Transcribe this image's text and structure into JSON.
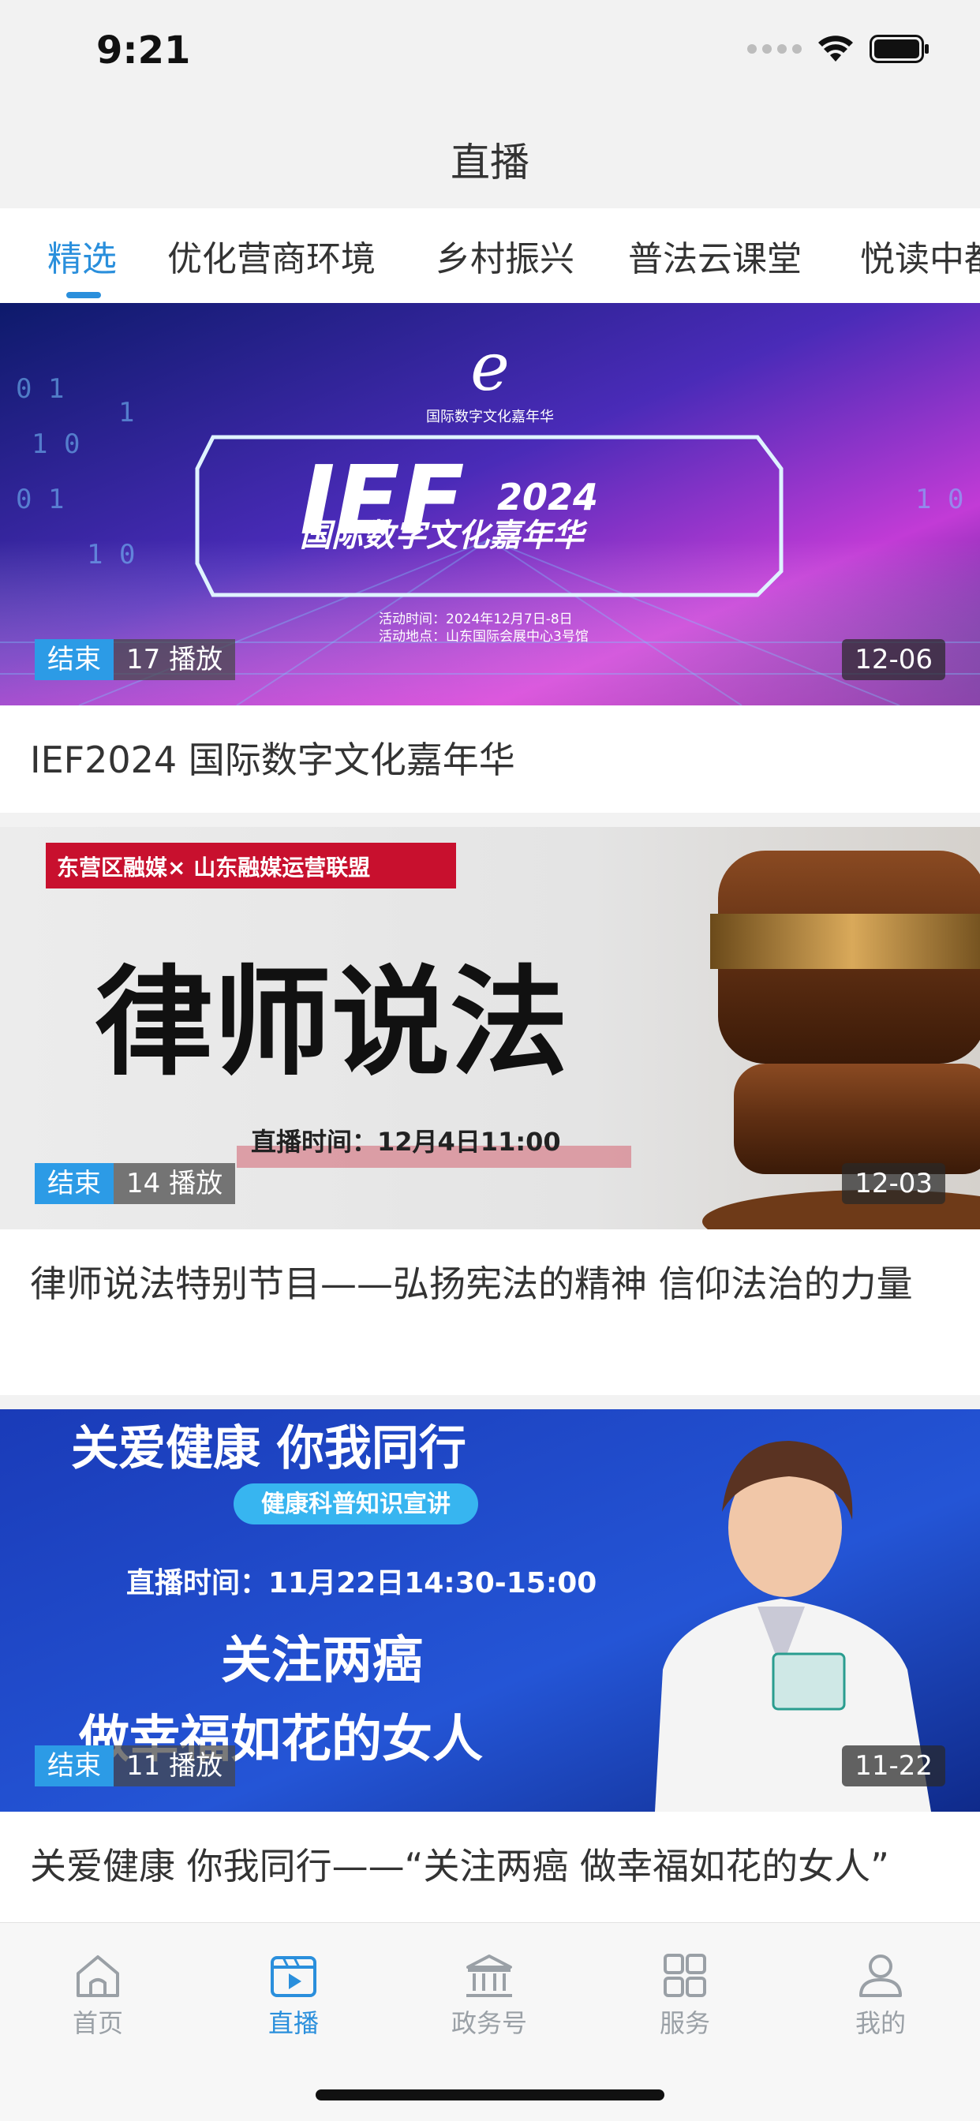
{
  "status_bar": {
    "time": "9:21"
  },
  "header": {
    "title": "直播"
  },
  "tabs": [
    {
      "label": "精选",
      "active": true
    },
    {
      "label": "优化营商环境",
      "active": false
    },
    {
      "label": "乡村振兴",
      "active": false
    },
    {
      "label": "普法云课堂",
      "active": false
    },
    {
      "label": "悦读中都",
      "active": false
    }
  ],
  "cards": [
    {
      "status": "结束",
      "plays": "17 播放",
      "date": "12-06",
      "title": "IEF2024 国际数字文化嘉年华",
      "thumb_text": {
        "logo_caption": "国际数字文化嘉年华",
        "big": "IEF",
        "year": "2024",
        "subtitle": "国际数字文化嘉年华",
        "line1": "活动时间：2024年12月7日-8日",
        "line2": "活动地点：山东国际会展中心3号馆"
      }
    },
    {
      "status": "结束",
      "plays": "14 播放",
      "date": "12-03",
      "title": "律师说法特别节目——弘扬宪法的精神 信仰法治的力量",
      "thumb_text": {
        "banner": "东营区融媒× 山东融媒运营联盟",
        "big": "律师说法",
        "time": "直播时间：12月4日11:00"
      }
    },
    {
      "status": "结束",
      "plays": "11 播放",
      "date": "11-22",
      "title": "关爱健康 你我同行——“关注两癌 做幸福如花的女人”",
      "thumb_text": {
        "headline": "关爱健康  你我同行",
        "pill": "健康科普知识宣讲",
        "time": "直播时间：11月22日14:30-15:00",
        "line1": "关注两癌",
        "line2": "做幸福如花的女人"
      }
    }
  ],
  "bottom_nav": [
    {
      "label": "首页",
      "icon": "home-icon",
      "active": false
    },
    {
      "label": "直播",
      "icon": "live-video-icon",
      "active": true
    },
    {
      "label": "政务号",
      "icon": "government-building-icon",
      "active": false
    },
    {
      "label": "服务",
      "icon": "grid-services-icon",
      "active": false
    },
    {
      "label": "我的",
      "icon": "user-profile-icon",
      "active": false
    }
  ],
  "colors": {
    "accent": "#2a8fdc",
    "badge_status": "#2c9be6",
    "inactive": "#9aa0a6"
  }
}
